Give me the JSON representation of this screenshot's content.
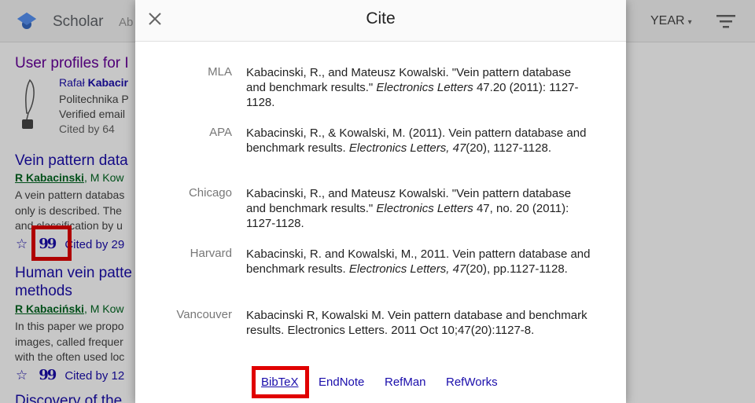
{
  "topbar": {
    "brand": "Scholar",
    "brand_sub": "Ab",
    "year_label": "YEAR",
    "year_caret": "▾"
  },
  "background": {
    "profiles_heading": "User profiles for I",
    "profile": {
      "name_plain": "Rafał ",
      "name_bold": "Kabacir",
      "affiliation": "Politechnika P",
      "verified": "Verified email",
      "cited": "Cited by 64"
    },
    "results": [
      {
        "title": "Vein pattern data",
        "author_main": "R Kabacinski",
        "author_rest": ", M Kow",
        "snippet": [
          "A vein pattern databas",
          "only is described. The",
          "and classification by u"
        ],
        "cited": "Cited by 29"
      },
      {
        "title": "Human vein patte",
        "title_line2": "methods",
        "author_main": "R Kabaciński",
        "author_rest": ", M Kow",
        "snippet": [
          "In this paper we propo",
          "images, called frequer",
          "with the often used loc"
        ],
        "cited": "Cited by 12"
      },
      {
        "title": "Discovery of the"
      }
    ],
    "star_glyph": "☆",
    "quote_glyph": "99"
  },
  "dialog": {
    "title": "Cite",
    "close_glyph": "×",
    "citations": [
      {
        "style": "MLA",
        "pre": "Kabacinski, R., and Mateusz Kowalski. \"Vein pattern database and benchmark results.\" ",
        "journal": "Electronics Letters",
        "post": " 47.20 (2011): 1127-1128."
      },
      {
        "style": "APA",
        "pre": "Kabacinski, R., & Kowalski, M. (2011). Vein pattern database and benchmark results. ",
        "journal": "Electronics Letters, 47",
        "post": "(20), 1127-1128."
      },
      {
        "style": "Chicago",
        "pre": "Kabacinski, R., and Mateusz Kowalski. \"Vein pattern database and benchmark results.\" ",
        "journal": "Electronics Letters",
        "post": " 47, no. 20 (2011): 1127-1128."
      },
      {
        "style": "Harvard",
        "pre": "Kabacinski, R. and Kowalski, M., 2011. Vein pattern database and benchmark results. ",
        "journal": "Electronics Letters, 47",
        "post": "(20), pp.1127-1128."
      },
      {
        "style": "Vancouver",
        "pre": "Kabacinski R, Kowalski M. Vein pattern database and benchmark results. Electronics Letters. 2011 Oct 10;47(20):1127-8.",
        "journal": "",
        "post": ""
      }
    ],
    "exports": [
      "BibTeX",
      "EndNote",
      "RefMan",
      "RefWorks"
    ]
  },
  "colors": {
    "highlight": "#e00000",
    "link": "#1a0dab",
    "author_green": "#006621"
  }
}
